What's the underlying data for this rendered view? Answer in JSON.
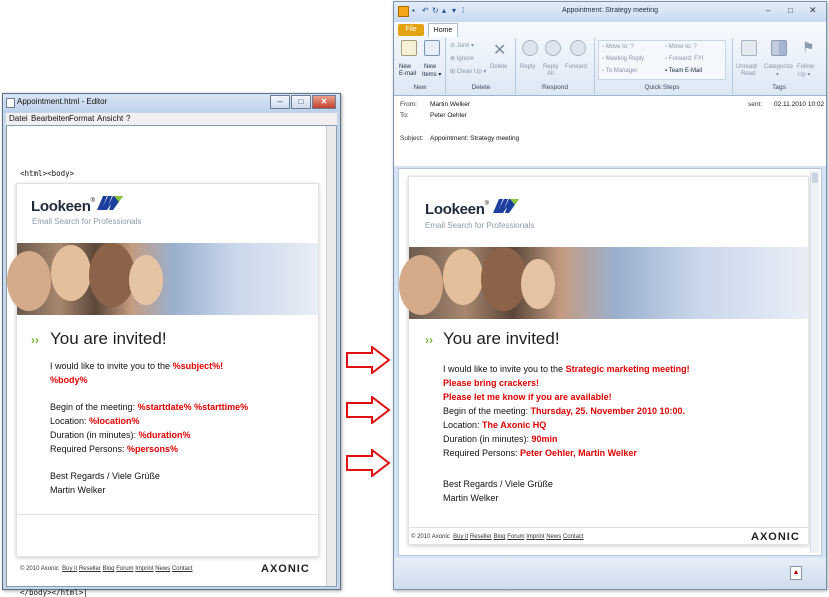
{
  "editor": {
    "title": "Appointment.html - Editor",
    "menu": [
      "Datei",
      "Bearbeiten",
      "Format",
      "Ansicht",
      "?"
    ],
    "code_open": "<html><body>",
    "code_close": "</body></html>|"
  },
  "template": {
    "logo": "Lookeen",
    "logo_reg": "®",
    "logo_sub": "Email Search for Professionals",
    "invite_chevrons": "››",
    "invite_heading": "You are invited!",
    "line1_prefix": "I would like to invite you to the ",
    "subject_ph": "%subject%!",
    "body_ph": "%body%",
    "begin_label": "Begin of the meeting: ",
    "start_ph": "%startdate% %starttime%",
    "location_label": "Location: ",
    "location_ph": "%location%",
    "duration_label": "Duration (in minutes): ",
    "duration_ph": "%duration%",
    "persons_label": "Required Persons: ",
    "persons_ph": "%persons%",
    "regards": "Best Regards / Viele Grüße",
    "signature": "Martin Welker",
    "footer_prefix": "© 2010 Axonic",
    "footer_links": [
      "Buy it",
      "Reseller",
      "Blog",
      "Forum",
      "Imprint",
      "News",
      "Contact"
    ],
    "brand": "AXONIC"
  },
  "outlook": {
    "window_title": "Appointment: Strategy meeting",
    "file_tab": "File",
    "home_tab": "Home",
    "ribbon": {
      "new_email": [
        "New",
        "E-mail"
      ],
      "new_items": [
        "New",
        "Items ▾"
      ],
      "junk": "Junk ▾",
      "ignore": "Ignore",
      "cleanup": "Clean Up ▾",
      "delete": "Delete",
      "reply": "Reply",
      "reply_all": [
        "Reply",
        "All"
      ],
      "forward": "Forward",
      "qs_move_to": "Move to: ?",
      "qs_meeting_reply": "Meeting Reply",
      "qs_to_manager": "To Manager",
      "qs_move_to2": "Move to: ?",
      "qs_forward_fyi": "Forward: FYI",
      "qs_team_email": "Team E-Mail",
      "unread": [
        "Unread/",
        "Read"
      ],
      "categorize": [
        "Categorize",
        "▾"
      ],
      "follow_up": [
        "Follow",
        "Up ▾"
      ],
      "groups": [
        "New",
        "Delete",
        "Respond",
        "Quick Steps",
        "Tags"
      ]
    },
    "header": {
      "from_label": "From:",
      "from": "Martin Welker",
      "to_label": "To:",
      "to": "Peter Oehler",
      "sent_label": "sent:",
      "sent": "02.11.2010 10:02",
      "subject_label": "Subject:",
      "subject": "Appointment: Strategy meeting"
    },
    "mail": {
      "subject_val": "Strategic marketing meeting!",
      "body_line1": "Please bring crackers!",
      "body_line2": "Please let me know if you are available!",
      "start_val": "Thursday, 25. November 2010 10:00.",
      "location_val": "The Axonic HQ",
      "duration_val": "90min",
      "persons_val": "Peter Oehler, Martin Welker"
    }
  },
  "colors": {
    "placeholder_red": "#e00000",
    "accent_green": "#7bb53a",
    "arrow_red": "#e01010"
  }
}
